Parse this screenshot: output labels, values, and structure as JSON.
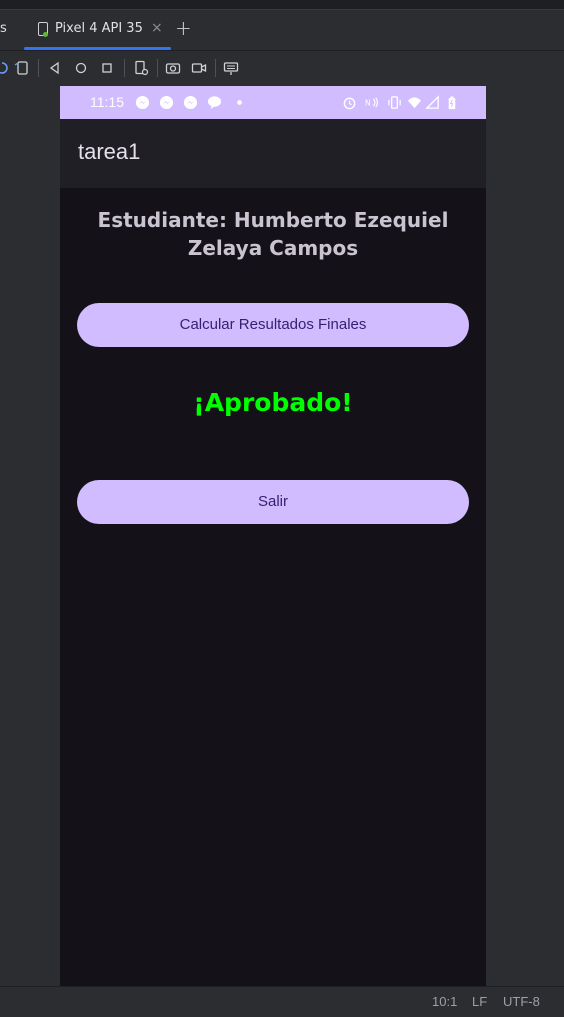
{
  "ide": {
    "partial_tab_label": "s",
    "active_tab_label": "Pixel 4 API 35",
    "close_glyph": "×",
    "add_glyph": "+",
    "toolbar_icons": [
      "rotate-icon",
      "device-frame-icon",
      "back-icon",
      "home-icon",
      "overview-icon",
      "device-settings-icon",
      "camera-icon",
      "screen-record-icon",
      "keyboard-icon"
    ],
    "status": {
      "cursor_position": "10:1",
      "line_separator": "LF",
      "encoding": "UTF-8"
    }
  },
  "device": {
    "status_bar": {
      "time": "11:15",
      "notification_icons": [
        "messenger-icon",
        "messenger-icon",
        "messenger-icon",
        "chat-bubble-icon",
        "dot-icon"
      ],
      "system_icons": [
        "alarm-icon",
        "nfc-icon",
        "vibrate-icon",
        "wifi-icon",
        "signal-icon",
        "battery-icon"
      ]
    },
    "app": {
      "title": "tarea1",
      "student_label": "Estudiante: Humberto Ezequiel Zelaya Campos",
      "calculate_button": "Calcular Resultados Finales",
      "result_text": "¡Aprobado!",
      "exit_button": "Salir"
    }
  },
  "colors": {
    "accent_purple": "#d0bcff",
    "button_text": "#381e72",
    "result_green": "#00ff00",
    "app_background": "#141218",
    "appbar_background": "#211f26",
    "ide_tab_underline": "#3574f0"
  }
}
